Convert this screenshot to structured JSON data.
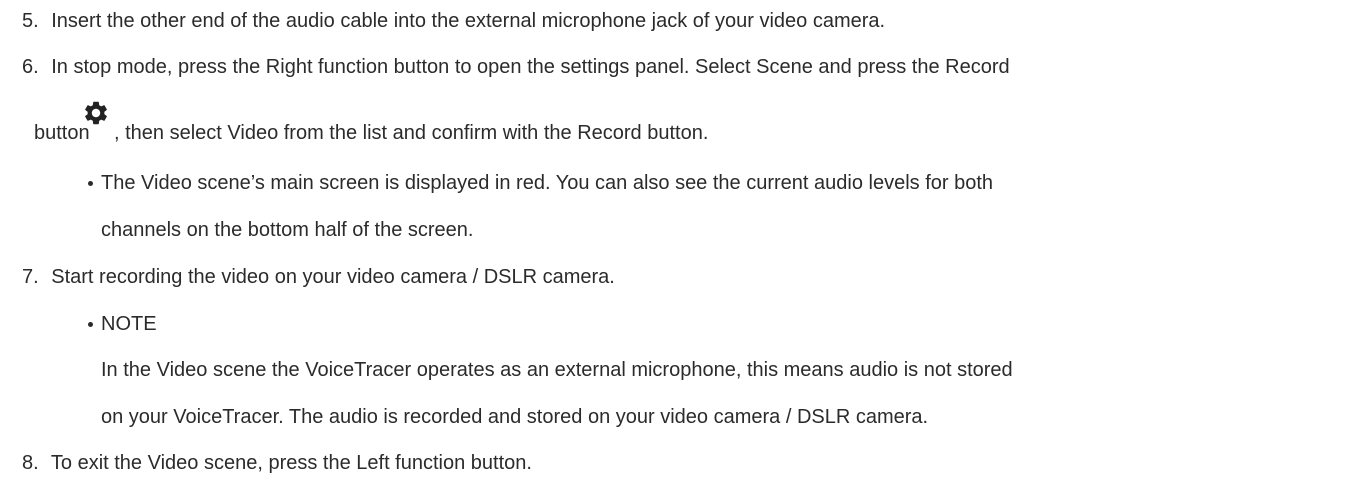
{
  "steps": [
    {
      "number": "5.",
      "text": "Insert the other end of the audio cable into the external microphone jack of your video camera."
    },
    {
      "number": "6.",
      "line1": "In stop mode, press the Right function button to open the settings panel. Select Scene and press the Record",
      "line2_before": "button",
      "line2_after": ", then select Video from the list and confirm with the Record button.",
      "icon": "gear-icon",
      "bullet": {
        "line1": "The Video scene’s main screen is displayed in red. You can also see the current audio levels for both",
        "line2": "channels on the bottom half of the screen."
      }
    },
    {
      "number": "7.",
      "text": "Start recording the video on your video camera / DSLR camera.",
      "bullet": {
        "label": "NOTE",
        "line1": "In the Video scene the VoiceTracer operates as an external microphone, this means audio is not stored",
        "line2": "on your VoiceTracer. The audio is recorded and stored on your video camera / DSLR camera."
      }
    },
    {
      "number": "8.",
      "text": "To exit the Video scene, press the Left function button."
    }
  ]
}
